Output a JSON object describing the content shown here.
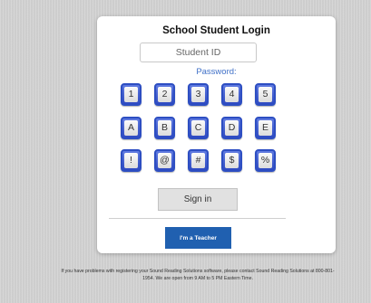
{
  "login": {
    "title": "School Student Login",
    "student_id_placeholder": "Student ID",
    "password_label": "Password:",
    "keypad_rows": [
      [
        "1",
        "2",
        "3",
        "4",
        "5"
      ],
      [
        "A",
        "B",
        "C",
        "D",
        "E"
      ],
      [
        "!",
        "@",
        "#",
        "$",
        "%"
      ]
    ],
    "sign_in_label": "Sign in",
    "teacher_button_label": "I'm a Teacher"
  },
  "footer": {
    "line1": "If you have problems with registering your Sound Reading Solutions software, please contact Sound Reading Solutions at 800-801-",
    "line2": "1954. We are open from 9 AM to 5 PM Eastern Time."
  },
  "colors": {
    "key_border": "#2d4ec2",
    "teacher_button": "#2060b0",
    "password_label": "#3e6fc7"
  }
}
